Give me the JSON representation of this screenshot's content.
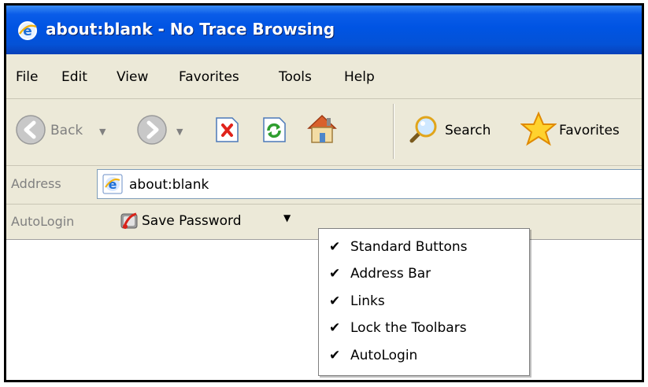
{
  "window": {
    "title": "about:blank - No Trace Browsing"
  },
  "menubar": {
    "items": [
      "File",
      "Edit",
      "View",
      "Favorites",
      "Tools",
      "Help"
    ]
  },
  "toolbar": {
    "back_label": "Back",
    "search_label": "Search",
    "favorites_label": "Favorites"
  },
  "address": {
    "label": "Address",
    "value": "about:blank"
  },
  "autologin": {
    "label": "AutoLogin",
    "save_label": "Save Password"
  },
  "context_menu": {
    "items": [
      {
        "label": "Standard Buttons",
        "checked": true
      },
      {
        "label": "Address Bar",
        "checked": true
      },
      {
        "label": "Links",
        "checked": true
      },
      {
        "label": "Lock the Toolbars",
        "checked": true
      },
      {
        "label": "AutoLogin",
        "checked": true
      }
    ]
  },
  "colors": {
    "titlebar": "#0054e3",
    "chrome": "#ece9d8",
    "address_border": "#7f9db9"
  }
}
